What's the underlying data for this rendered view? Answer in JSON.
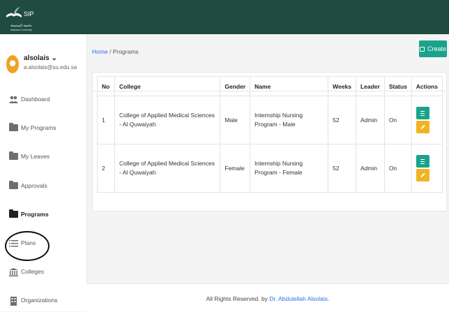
{
  "app": {
    "title": "SIP",
    "logo_text_ar": "جامعة المجمعة",
    "logo_text_en": "Majmaah University"
  },
  "user": {
    "name": "alsolais",
    "caret": "⌄",
    "email": "a.alsolais@su.edu.sa"
  },
  "sidebar": {
    "items": [
      {
        "label": "Dashboard",
        "icon": "users-icon"
      },
      {
        "label": "My Programs",
        "icon": "folder-icon"
      },
      {
        "label": "My Leaves",
        "icon": "folder-icon"
      },
      {
        "label": "Approvals",
        "icon": "folder-icon"
      },
      {
        "label": "Programs",
        "icon": "folder-icon",
        "active": true
      },
      {
        "label": "Plans",
        "icon": "list-icon"
      },
      {
        "label": "Colleges",
        "icon": "bank-icon"
      },
      {
        "label": "Organizations",
        "icon": "building-icon"
      }
    ]
  },
  "breadcrumb": {
    "home": "Home",
    "separator": "/",
    "current": "Programs"
  },
  "toolbar": {
    "create_label": "Create"
  },
  "table": {
    "headers": [
      "No",
      "College",
      "Gender",
      "Name",
      "Weeks",
      "Leader",
      "Status",
      "Actions"
    ],
    "rows": [
      {
        "no": "1",
        "college": "College of Applied Medical Sciences - Al Quwaiyah",
        "gender": "Male",
        "name": "Internship Nursing Program - Male",
        "weeks": "52",
        "leader": "Admin",
        "status": "On"
      },
      {
        "no": "2",
        "college": "College of Applied Medical Sciences - Al Quwaiyah",
        "gender": "Female",
        "name": "Internship Nursing Program - Female",
        "weeks": "52",
        "leader": "Admin",
        "status": "On"
      }
    ]
  },
  "footer": {
    "text": "All Rights Reserved. by",
    "author": "Dr. Abdulellah Alsolais",
    "suffix": "."
  },
  "colors": {
    "topbar": "#1f4b40",
    "accent": "#1aa38a",
    "edit": "#f1b420",
    "link": "#2a6df4"
  }
}
